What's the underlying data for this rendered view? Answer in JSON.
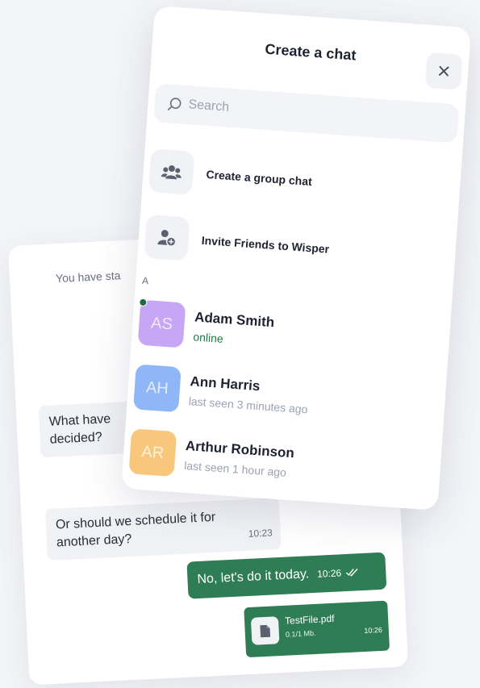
{
  "chat": {
    "system_text": "You have sta",
    "messages": [
      {
        "text": "What have\ndecided?"
      },
      {
        "text": "Or should we schedule it for another day?",
        "time": "10:23"
      },
      {
        "text": "No, let's do it today.",
        "time": "10:26"
      }
    ],
    "file": {
      "name": "TestFile.pdf",
      "size": "0.1/1 Mb.",
      "time": "10:26"
    }
  },
  "modal": {
    "title": "Create a chat",
    "close_icon": "close-icon",
    "search": {
      "placeholder": "Search",
      "value": ""
    },
    "actions": [
      {
        "label": "Create a group chat",
        "icon": "group-icon"
      },
      {
        "label": "Invite Friends to Wisper",
        "icon": "add-user-icon"
      }
    ],
    "section": "A",
    "contacts": [
      {
        "initials": "AS",
        "name": "Adam Smith",
        "status": "online",
        "color": "#c7a6f5",
        "online": true
      },
      {
        "initials": "AH",
        "name": "Ann Harris",
        "status": "last seen 3 minutes ago",
        "color": "#8fb6f7",
        "online": false
      },
      {
        "initials": "AR",
        "name": "Arthur Robinson",
        "status": "last seen 1 hour ago",
        "color": "#f9c77c",
        "online": false
      }
    ]
  },
  "colors": {
    "accent_green": "#2f7d55",
    "online_green": "#1f7a45"
  }
}
